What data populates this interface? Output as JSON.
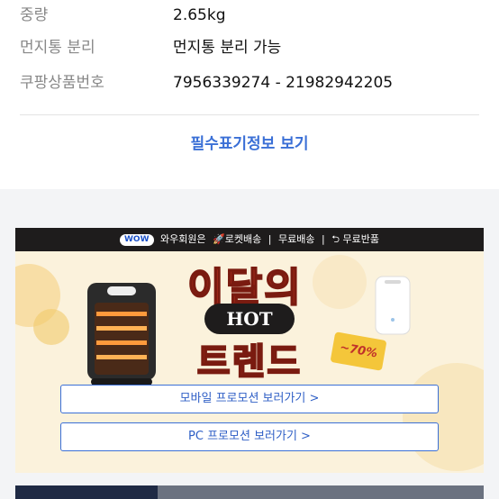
{
  "specs": {
    "rows": [
      {
        "label": "중량",
        "value": "2.65kg"
      },
      {
        "label": "먼지통 분리",
        "value": "먼지통 분리 가능"
      },
      {
        "label": "쿠팡상품번호",
        "value": "7956339274 - 21982942205"
      }
    ],
    "more_link": "필수표기정보 보기"
  },
  "banner": {
    "top": {
      "wow_badge": "WOW",
      "wow_text": "와우회원은",
      "rocket": "🚀로켓배송",
      "sep1": "|",
      "free_shipping": "무료배송",
      "sep2": "|",
      "free_return": "⮌ 무료반품"
    },
    "title_line1": "이달의",
    "hot_label": "HOT",
    "title_line2": "트렌드",
    "discount": "~70%",
    "mobile_button": "모바일 프로모션 보러가기 >",
    "pc_button": "PC 프로모션 보러가기 >"
  },
  "colors": {
    "accent": "#3a6fd6",
    "banner_bg": "#fbf2dc",
    "title_red": "#f0452a"
  }
}
